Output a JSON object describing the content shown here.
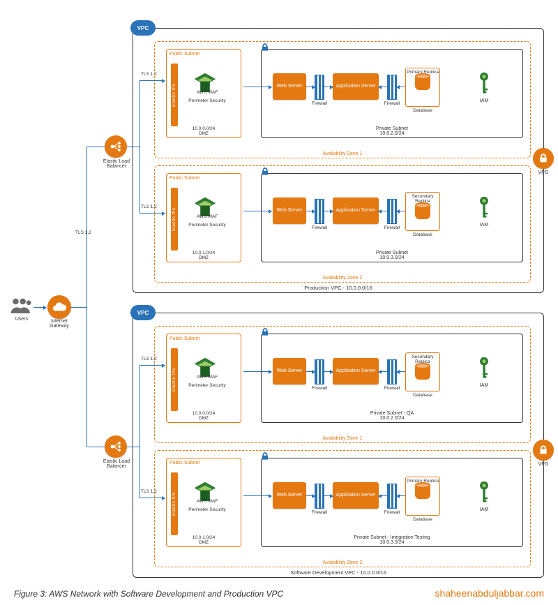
{
  "caption": "Figure 3: AWS Network with Software Development and Production VPC",
  "attribution": "shaheenabduljabbar.com",
  "left": {
    "users_label": "Users",
    "igw_label": "Internet Gateway",
    "tls_backbone": "TLS 1.2"
  },
  "elb": {
    "label": "Elastic Load Balancer"
  },
  "vpg": {
    "label": "VPG"
  },
  "vpc_tag": "VPC",
  "tls_branch": "TLS 1.2",
  "vpcs": [
    {
      "footer": "Production VPC - 10.0.0.0/16",
      "zones": [
        {
          "name": "Availability Zone 1",
          "public": {
            "title": "Public Subnet",
            "eip": "Elastic IPs",
            "waf": "AWS WAF",
            "perimeter": "Perimeter Security",
            "cidr_a": "10.0.0.0/24",
            "cidr_b": "DMZ"
          },
          "private": {
            "label_a": "Private Subnet",
            "label_b": "10.0.2.0/24",
            "web": "Web Server",
            "app": "Application Server",
            "fw": "Firewall",
            "db_top": "Primary Replica",
            "db_bottom": "Database",
            "iam": "IAM"
          }
        },
        {
          "name": "Availability Zone 2",
          "public": {
            "title": "Public Subnet",
            "eip": "Elastic IPs",
            "waf": "AWS WAF",
            "perimeter": "Perimeter Security",
            "cidr_a": "10.0.1.0/24",
            "cidr_b": "DMZ"
          },
          "private": {
            "label_a": "Private Subnet",
            "label_b": "10.0.3.0/24",
            "web": "Web Server",
            "app": "Application Server",
            "fw": "Firewall",
            "db_top": "Secondary Replica",
            "db_bottom": "Database",
            "iam": "IAM"
          }
        }
      ]
    },
    {
      "footer": "Software Development VPC - 10.0.0.0/16",
      "zones": [
        {
          "name": "Availability Zone 1",
          "public": {
            "title": "Public Subnet",
            "eip": "Elastic IPs",
            "waf": "AWS WAF",
            "perimeter": "Perimeter Security",
            "cidr_a": "10.0.0.0/24",
            "cidr_b": "DMZ"
          },
          "private": {
            "label_a": "Private Subnet - QA",
            "label_b": "10.0.2.0/24",
            "web": "Web Server",
            "app": "Application Server",
            "fw": "Firewall",
            "db_top": "Secondary Replica",
            "db_bottom": "Database",
            "iam": "IAM"
          }
        },
        {
          "name": "Availability Zone 2",
          "public": {
            "title": "Public Subnet",
            "eip": "Elastic IPs",
            "waf": "AWS WAF",
            "perimeter": "Perimeter Security",
            "cidr_a": "10.0.1.0/24",
            "cidr_b": "DMZ"
          },
          "private": {
            "label_a": "Private Subnet - Integration Testing",
            "label_b": "10.0.3.0/24",
            "web": "Web Server",
            "app": "Application Server",
            "fw": "Firewall",
            "db_top": "Primary Replica",
            "db_bottom": "Database",
            "iam": "IAM"
          }
        }
      ]
    }
  ]
}
